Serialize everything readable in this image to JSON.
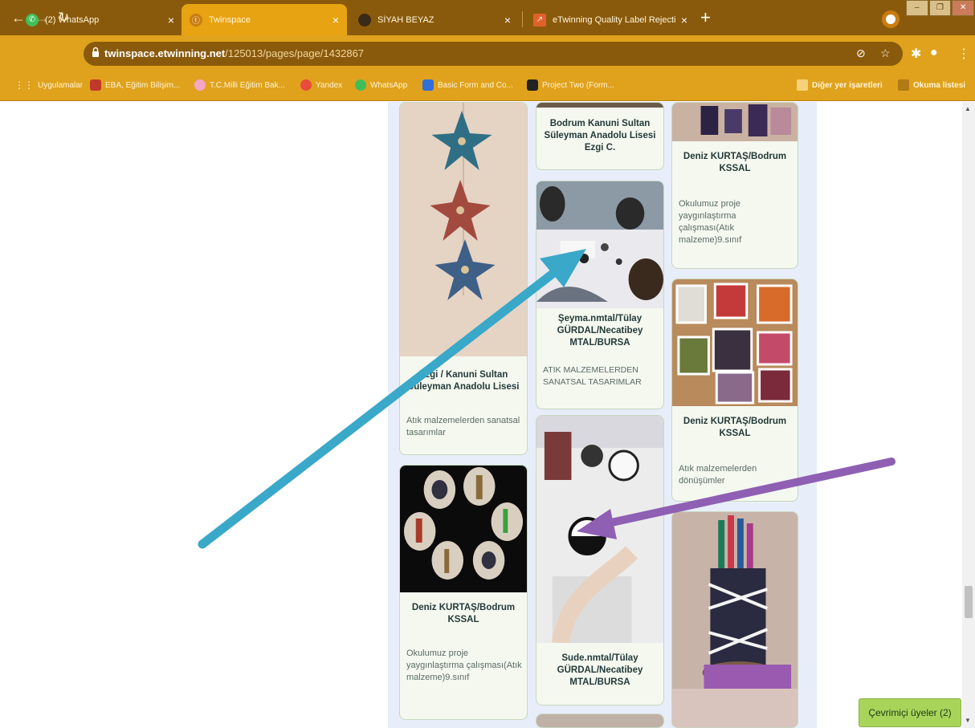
{
  "browser": {
    "tabs": [
      {
        "label": "(2) WhatsApp",
        "favicon": "whatsapp-icon",
        "active": false
      },
      {
        "label": "Twinspace",
        "favicon": "twinspace-icon",
        "active": true
      },
      {
        "label": "SİYAH BEYAZ",
        "favicon": "person-icon",
        "active": false
      },
      {
        "label": "eTwinning Quality Label Rejecti",
        "favicon": "chart-icon",
        "active": false
      }
    ],
    "close_glyph": "×",
    "new_tab_glyph": "+",
    "url_host": "twinspace.etwinning.net",
    "url_path": "/125013/pages/page/1432867",
    "bookmarks": [
      {
        "label": "Uygulamalar",
        "color": "#f6d27a"
      },
      {
        "label": "EBA, Eğitim Bilişim...",
        "color": "#c0392b"
      },
      {
        "label": "T.C.Milli Eğitim Bak...",
        "color": "#f4a6c8"
      },
      {
        "label": "Yandex",
        "color": "#e74c3c"
      },
      {
        "label": "WhatsApp",
        "color": "#3fbf5a"
      },
      {
        "label": "Basic Form and Co...",
        "color": "#2f6fd6"
      },
      {
        "label": "Project Two (Form...",
        "color": "#222222"
      }
    ],
    "bookmarks_right": [
      {
        "label": "Diğer yer işaretleri"
      },
      {
        "label": "Okuma listesi"
      }
    ]
  },
  "cards": {
    "c1": {
      "title": "Bodrum Kanuni Sultan Süleyman Anadolu Lisesi Ezgi C.",
      "desc": ""
    },
    "c2": {
      "title": "Deniz KURTAŞ/Bodrum KSSAL",
      "desc": "Okulumuz proje yaygınlaştırma çalışması(Atık malzeme)9.sınıf"
    },
    "c3": {
      "title": "Şeyma.nmtal/Tülay GÜRDAL/Necatibey MTAL/BURSA",
      "desc": "ATIK MALZEMELERDEN SANATSAL TASARIMLAR"
    },
    "c4": {
      "title": "Ezgi / Kanuni Sultan Süleyman Anadolu Lisesi",
      "desc": "Atık malzemelerden sanatsal tasarımlar"
    },
    "c5": {
      "title": "Deniz KURTAŞ/Bodrum KSSAL",
      "desc": "Atık malzemelerden dönüşümler"
    },
    "c6": {
      "title": "Deniz KURTAŞ/Bodrum KSSAL",
      "desc": "Okulumuz proje yaygınlaştırma çalışması(Atık malzeme)9.sınıf"
    },
    "c7": {
      "title": "Sude.nmtal/Tülay GÜRDAL/Necatibey MTAL/BURSA",
      "desc": ""
    }
  },
  "online": {
    "label": "Çevrimiçi üyeler (2)"
  },
  "colors": {
    "tab_bar": "#8a5a0c",
    "toolbar": "#e0a21c",
    "active_tab": "#e8a312",
    "board": "#e7eef9",
    "arrow_blue": "#3aa8c8",
    "arrow_purple": "#8e5fb3"
  }
}
